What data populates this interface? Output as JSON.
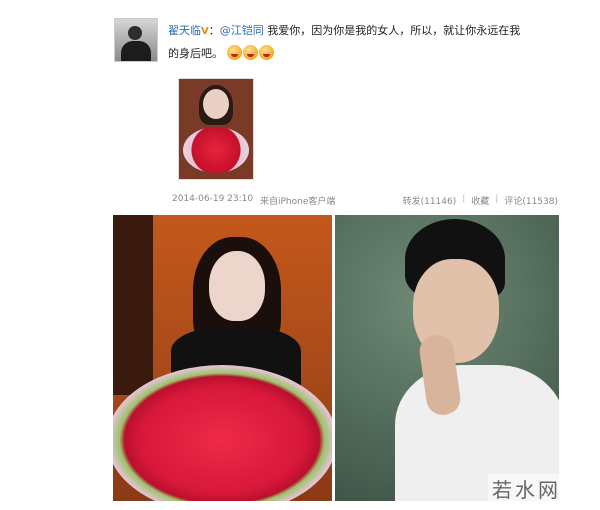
{
  "post": {
    "username": "翟天临",
    "vip_badge": "V",
    "mention": "@江铠同",
    "text_line1": "我爱你，因为你是我的女人，所以，就让你永远在我",
    "text_line2": "的身后吧。"
  },
  "meta": {
    "timestamp": "2014-06-19 23:10",
    "source": "来自iPhone客户端",
    "repost": "转发(11146)",
    "favorite": "收藏",
    "comment": "评论(11538)",
    "separator": "|"
  },
  "watermark": "若水网"
}
